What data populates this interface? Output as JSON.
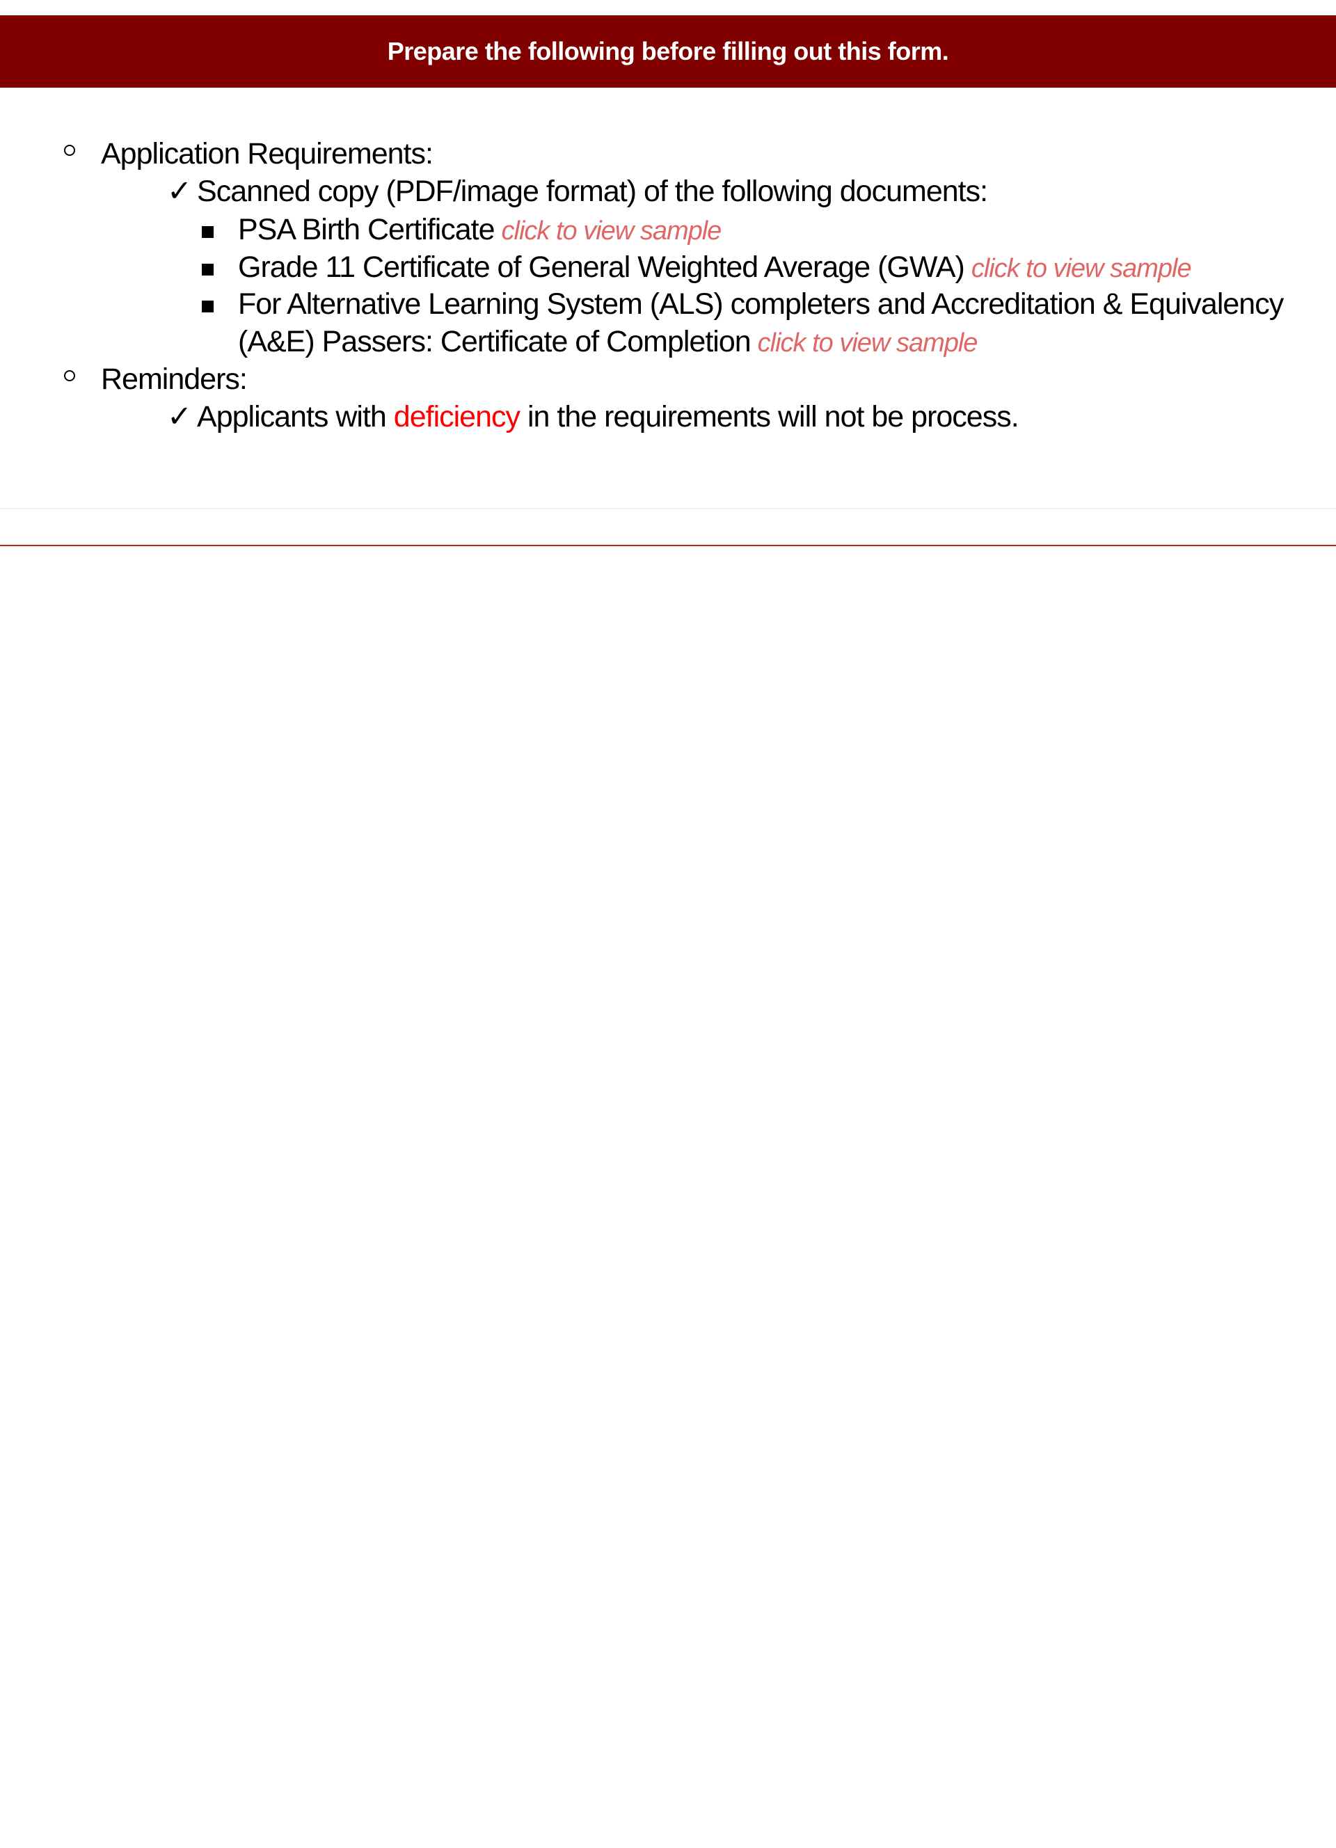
{
  "banner": {
    "title": "Prepare the following before filling out this form."
  },
  "requirements": {
    "heading": "Application Requirements:",
    "check_symbol": "✓",
    "scanned_copy": "Scanned copy (PDF/image format) of the following documents:",
    "documents": [
      {
        "label": "PSA Birth Certificate",
        "link": "click to view sample"
      },
      {
        "label": "Grade 11 Certificate of General Weighted Average (GWA)",
        "link": "click to view sample"
      },
      {
        "label": "For Alternative Learning System (ALS) completers and Accreditation & Equivalency",
        "label_cont": "(A&E) Passers: Certificate of Completion",
        "link": "click to view sample"
      }
    ]
  },
  "reminders": {
    "heading": "Reminders:",
    "text_before": "Applicants with ",
    "highlight": "deficiency",
    "text_after": " in the requirements will not be process."
  },
  "colors": {
    "banner_bg": "#800000",
    "link": "#e06666",
    "highlight": "#ff0000",
    "divider": "#c0282d"
  }
}
